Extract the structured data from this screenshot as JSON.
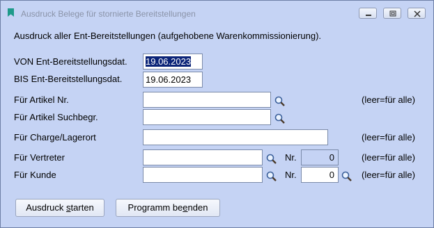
{
  "window": {
    "title": "Ausdruck Belege für stornierte Bereitstellungen",
    "buttons": {
      "minimize": "minimize",
      "maximize": "maximize",
      "close": "close"
    }
  },
  "header": "Ausdruck aller Ent-Bereitstellungen (aufgehobene Warenkommissionierung).",
  "von": {
    "label": "VON Ent-Bereitstellungsdat.",
    "value": "19.06.2023"
  },
  "bis": {
    "label": "BIS Ent-Bereitstellungsdat.",
    "value": "19.06.2023"
  },
  "artikel_nr": {
    "label": "Für Artikel Nr.",
    "value": "",
    "hint": "(leer=für alle)"
  },
  "artikel_such": {
    "label": "Für Artikel Suchbegr.",
    "value": ""
  },
  "charge": {
    "label": "Für Charge/Lagerort",
    "value": "",
    "hint": "(leer=für alle)"
  },
  "vertreter": {
    "label": "Für Vertreter",
    "value": "",
    "nr_label": "Nr.",
    "nr_value": "0",
    "hint": "(leer=für alle)"
  },
  "kunde": {
    "label": "Für Kunde",
    "value": "",
    "nr_label": "Nr.",
    "nr_value": "0",
    "hint": "(leer=für alle)"
  },
  "actions": {
    "start": {
      "pre": "Ausdruck ",
      "mnemonic": "s",
      "post": "tarten"
    },
    "end": {
      "pre": "Programm be",
      "mnemonic": "e",
      "post": "nden"
    }
  },
  "icons": {
    "search": "magnifier-icon",
    "window": "bookmark-icon"
  },
  "colors": {
    "background": "#c5d3f4",
    "selection": "#0b2478"
  }
}
